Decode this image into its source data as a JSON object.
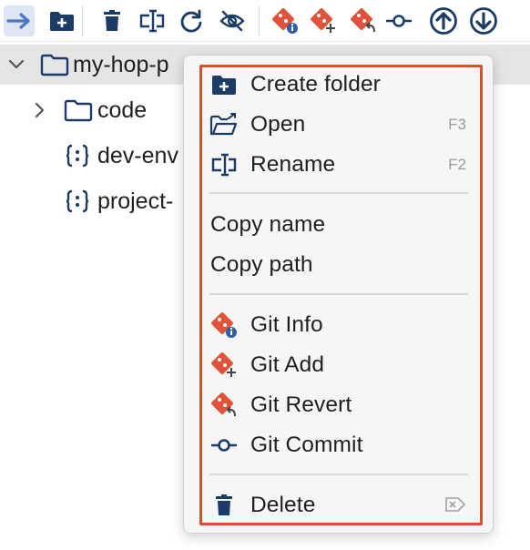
{
  "toolbar": {
    "buttons": [
      {
        "icon": "arrow-right-icon",
        "active": true
      },
      {
        "icon": "create-folder-icon"
      },
      {
        "icon": "trash-icon"
      },
      {
        "icon": "rename-icon"
      },
      {
        "icon": "refresh-icon"
      },
      {
        "icon": "hide-icon"
      },
      {
        "icon": "git-info-icon"
      },
      {
        "icon": "git-add-icon"
      },
      {
        "icon": "git-revert-icon"
      },
      {
        "icon": "git-commit-icon"
      },
      {
        "icon": "git-push-icon"
      },
      {
        "icon": "git-pull-icon"
      }
    ]
  },
  "tree": {
    "root": {
      "label": "my-hop-p",
      "expanded": true
    },
    "children": [
      {
        "label": "code",
        "type": "folder"
      },
      {
        "label": "dev-env",
        "type": "json"
      },
      {
        "label": "project-",
        "type": "json"
      }
    ]
  },
  "menu": {
    "create_folder": {
      "label": "Create folder"
    },
    "open": {
      "label": "Open",
      "shortcut": "F3"
    },
    "rename": {
      "label": "Rename",
      "shortcut": "F2"
    },
    "copy_name": {
      "label": "Copy name"
    },
    "copy_path": {
      "label": "Copy path"
    },
    "git_info": {
      "label": "Git Info"
    },
    "git_add": {
      "label": "Git Add"
    },
    "git_revert": {
      "label": "Git Revert"
    },
    "git_commit": {
      "label": "Git Commit"
    },
    "delete": {
      "label": "Delete",
      "shortcut_icon": "delete-key-icon"
    }
  },
  "colors": {
    "accent_blue": "#1a3c66",
    "git_red": "#e0523a",
    "highlight_border": "#e4472c",
    "selected_row": "#e5e5e5"
  }
}
